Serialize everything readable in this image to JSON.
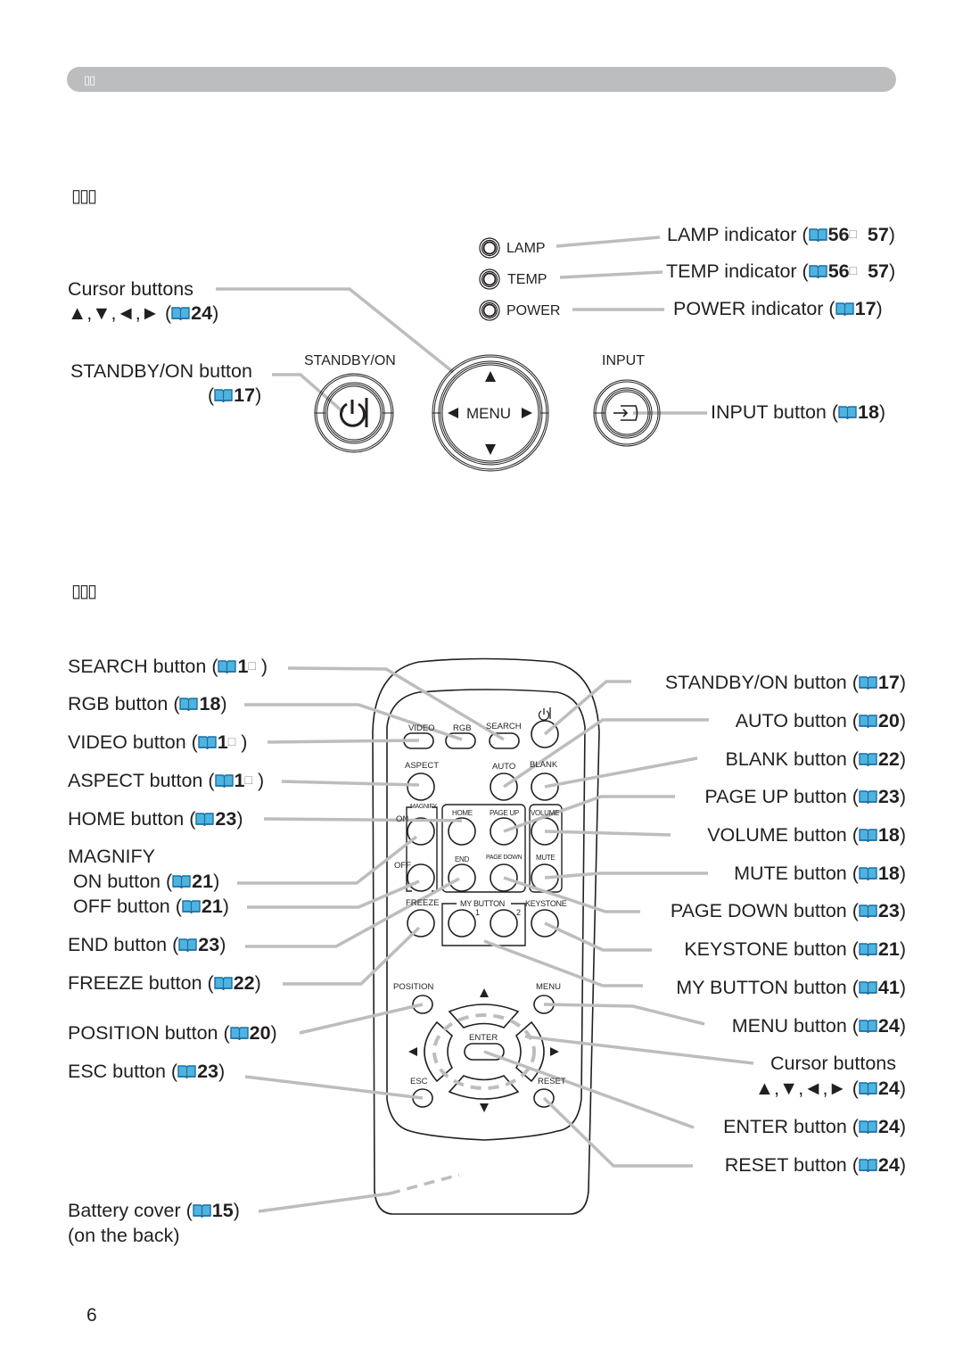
{
  "header": {
    "section_glyph": "▯▯"
  },
  "control_panel": {
    "section_glyph": "▯▯▯",
    "panel_labels": {
      "lamp": "LAMP",
      "temp": "TEMP",
      "power": "POWER",
      "standby_on": "STANDBY/ON",
      "input": "INPUT",
      "menu": "MENU"
    },
    "callouts": {
      "lamp": {
        "text": "LAMP indicator (",
        "ref": "56",
        "ref_sep": "□",
        "ref2": "57",
        "close": ")"
      },
      "temp": {
        "text": "TEMP indicator (",
        "ref": "56",
        "ref_sep": "□",
        "ref2": "57",
        "close": ")"
      },
      "power": {
        "text": "POWER indicator (",
        "ref": "17",
        "close": ")"
      },
      "cursor_line1": "Cursor buttons",
      "cursor_line2": "▲,▼,◄,► (",
      "cursor_ref": "24",
      "standby_line1": "STANDBY/ON button",
      "standby_ref": "17",
      "input": {
        "text": "INPUT button (",
        "ref": "18",
        "close": ")"
      }
    }
  },
  "remote": {
    "section_glyph": "▯▯▯",
    "keys": {
      "video": "VIDEO",
      "rgb": "RGB",
      "search": "SEARCH",
      "aspect": "ASPECT",
      "auto": "AUTO",
      "blank": "BLANK",
      "magnify": "MAGNIFY",
      "on": "ON",
      "off": "OFF",
      "home": "HOME",
      "page_up": "PAGE UP",
      "volume": "VOLUME",
      "end": "END",
      "page_down": "PAGE DOWN",
      "mute": "MUTE",
      "freeze": "FREEZE",
      "my_button": "MY BUTTON",
      "one": "1",
      "two": "2",
      "keystone": "KEYSTONE",
      "position": "POSITION",
      "menu": "MENU",
      "enter": "ENTER",
      "esc": "ESC",
      "reset": "RESET"
    },
    "left_callouts": [
      {
        "text": "SEARCH button (",
        "ref": "1",
        "tofu": "□",
        "close": ")"
      },
      {
        "text": "RGB button (",
        "ref": "18",
        "close": ")"
      },
      {
        "text": "VIDEO button (",
        "ref": "1",
        "tofu": "□",
        "close": ")"
      },
      {
        "text": "ASPECT button (",
        "ref": "1",
        "tofu": "□",
        "close": ")"
      },
      {
        "text": "HOME button (",
        "ref": "23",
        "close": ")"
      },
      {
        "text": "MAGNIFY"
      },
      {
        "text": "ON button (",
        "ref": "21",
        "close": ")"
      },
      {
        "text": "OFF button (",
        "ref": "21",
        "close": ")"
      },
      {
        "text": "END button (",
        "ref": "23",
        "close": ")"
      },
      {
        "text": "FREEZE button (",
        "ref": "22",
        "close": ")"
      },
      {
        "text": "POSITION button (",
        "ref": "20",
        "close": ")"
      },
      {
        "text": "ESC button (",
        "ref": "23",
        "close": ")"
      },
      {
        "text": "Battery cover (",
        "ref": "15",
        "close": ")",
        "line2": "(on the back)"
      }
    ],
    "right_callouts": [
      {
        "text": "STANDBY/ON button (",
        "ref": "17",
        "close": ")"
      },
      {
        "text": "AUTO button (",
        "ref": "20",
        "close": ")"
      },
      {
        "text": "BLANK button (",
        "ref": "22",
        "close": ")"
      },
      {
        "text": "PAGE UP button (",
        "ref": "23",
        "close": ")"
      },
      {
        "text": "VOLUME button (",
        "ref": "18",
        "close": ")"
      },
      {
        "text": "MUTE button (",
        "ref": "18",
        "close": ")"
      },
      {
        "text": "PAGE DOWN button (",
        "ref": "23",
        "close": ")"
      },
      {
        "text": "KEYSTONE button (",
        "ref": "21",
        "close": ")"
      },
      {
        "text": "MY BUTTON button (",
        "ref": "41",
        "close": ")"
      },
      {
        "text": "MENU button (",
        "ref": "24",
        "close": ")"
      },
      {
        "text": "Cursor buttons"
      },
      {
        "text": "▲,▼,◄,► (",
        "ref": "24",
        "close": ")"
      },
      {
        "text": "ENTER button (",
        "ref": "24",
        "close": ")"
      },
      {
        "text": "RESET button (",
        "ref": "24",
        "close": ")"
      }
    ]
  },
  "colors": {
    "header_bar": "#bcbdbf",
    "book_icon": "#1c8ec9",
    "leader_line": "#bcbdbf",
    "text": "#231f20"
  },
  "footer": {
    "page_number": "6"
  }
}
